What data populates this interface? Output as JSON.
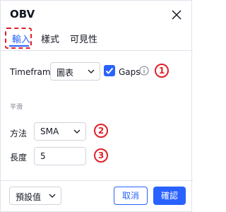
{
  "dialog": {
    "title": "OBV",
    "close_icon": "close-icon"
  },
  "tabs": [
    {
      "label": "輸入",
      "active": true
    },
    {
      "label": "樣式",
      "active": false
    },
    {
      "label": "可見性",
      "active": false
    }
  ],
  "inputs": {
    "timeframe_label": "Timeframe",
    "timeframe_value": "圖表",
    "gaps_label": "Gaps",
    "gaps_checked": true,
    "section_label": "平滑",
    "method_label": "方法",
    "method_value": "SMA",
    "length_label": "長度",
    "length_value": "5"
  },
  "markers": [
    "1",
    "2",
    "3"
  ],
  "footer": {
    "defaults_label": "預設值",
    "cancel_label": "取消",
    "ok_label": "確認"
  },
  "colors": {
    "accent": "#2962ff",
    "marker": "#e0202a"
  }
}
